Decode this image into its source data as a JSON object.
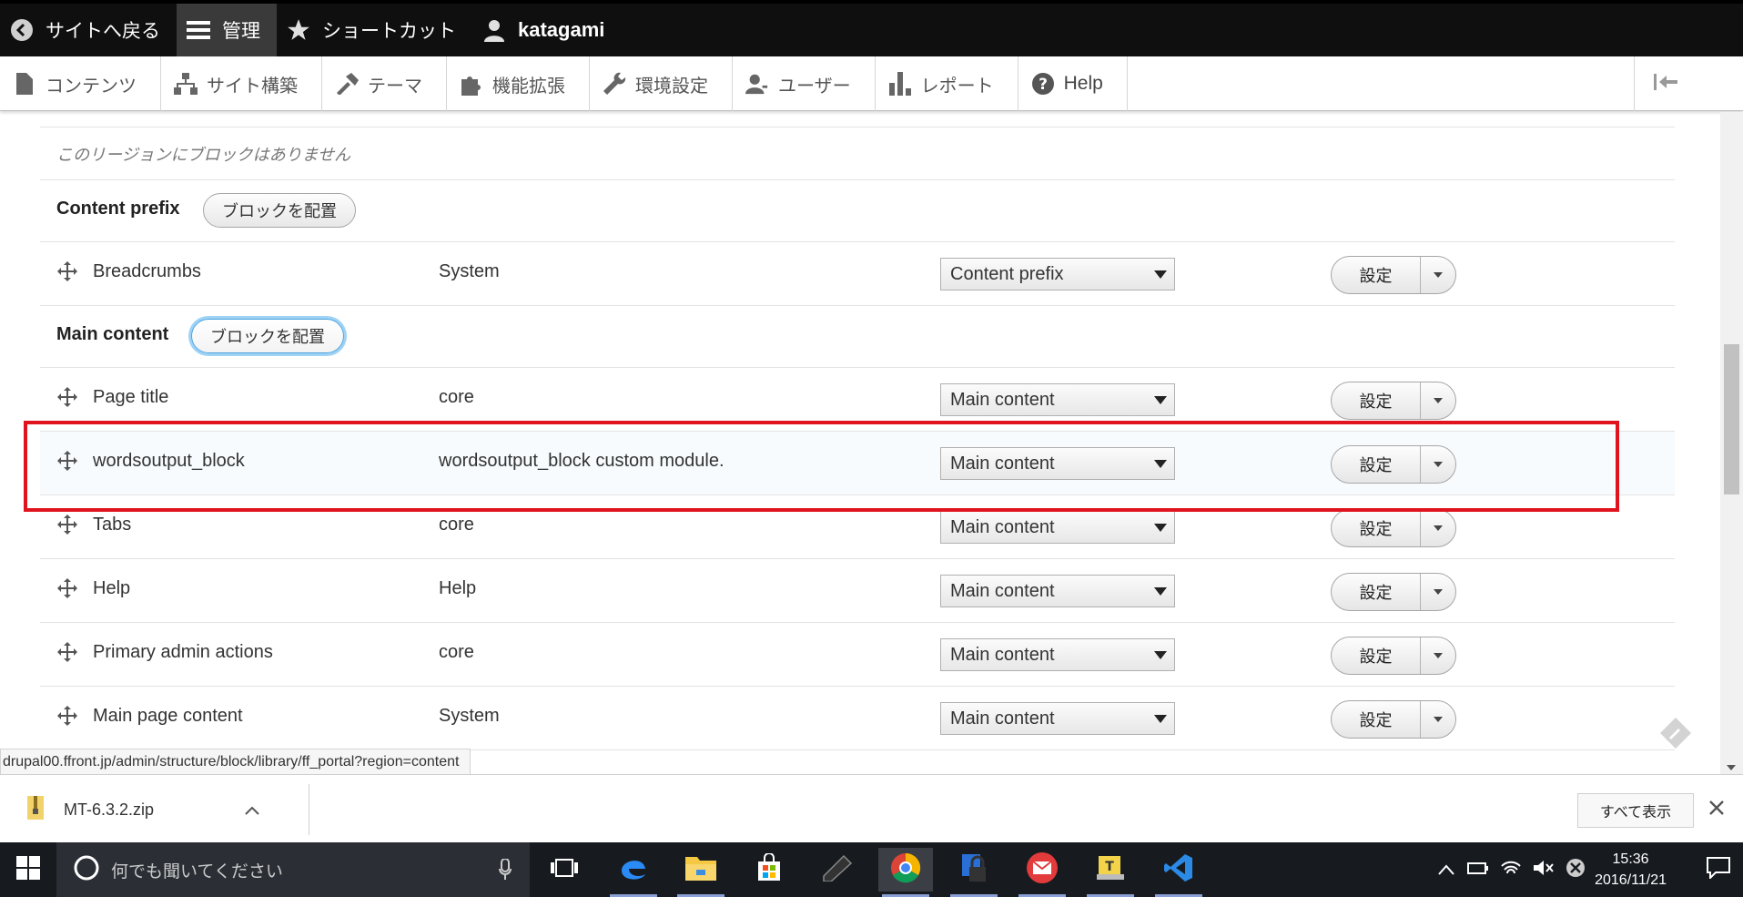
{
  "toolbar": {
    "back": "サイトへ戻る",
    "manage": "管理",
    "shortcuts": "ショートカット",
    "user": "katagami"
  },
  "tray": {
    "content": "コンテンツ",
    "structure": "サイト構築",
    "theme": "テーマ",
    "extend": "機能拡張",
    "config": "環境設定",
    "people": "ユーザー",
    "reports": "レポート",
    "help": "Help"
  },
  "blocks": {
    "empty_message": "このリージョンにブロックはありません",
    "place_label": "ブロックを配置",
    "configure_label": "設定",
    "regions": [
      {
        "title": "Content prefix"
      },
      {
        "title": "Main content"
      }
    ],
    "rows": [
      {
        "name": "Breadcrumbs",
        "category": "System",
        "region": "Content prefix"
      },
      {
        "name": "Page title",
        "category": "core",
        "region": "Main content"
      },
      {
        "name": "wordsoutput_block",
        "category": "wordsoutput_block custom module.",
        "region": "Main content",
        "highlighted": true
      },
      {
        "name": "Tabs",
        "category": "core",
        "region": "Main content"
      },
      {
        "name": "Help",
        "category": "Help",
        "region": "Main content"
      },
      {
        "name": "Primary admin actions",
        "category": "core",
        "region": "Main content"
      },
      {
        "name": "Main page content",
        "category": "System",
        "region": "Main content"
      }
    ],
    "highlight_color": "#e0141e"
  },
  "status_url": "drupal00.ffront.jp/admin/structure/block/library/ff_portal?region=content",
  "download_bar": {
    "file_name": "MT-6.3.2.zip",
    "show_all": "すべて表示"
  },
  "taskbar": {
    "search_placeholder": "何でも聞いてください",
    "time": "15:36",
    "date": "2016/11/21"
  },
  "colors": {
    "toolbar_bg": "#0f0f0f",
    "focus_ring": "#9ed3f6"
  }
}
